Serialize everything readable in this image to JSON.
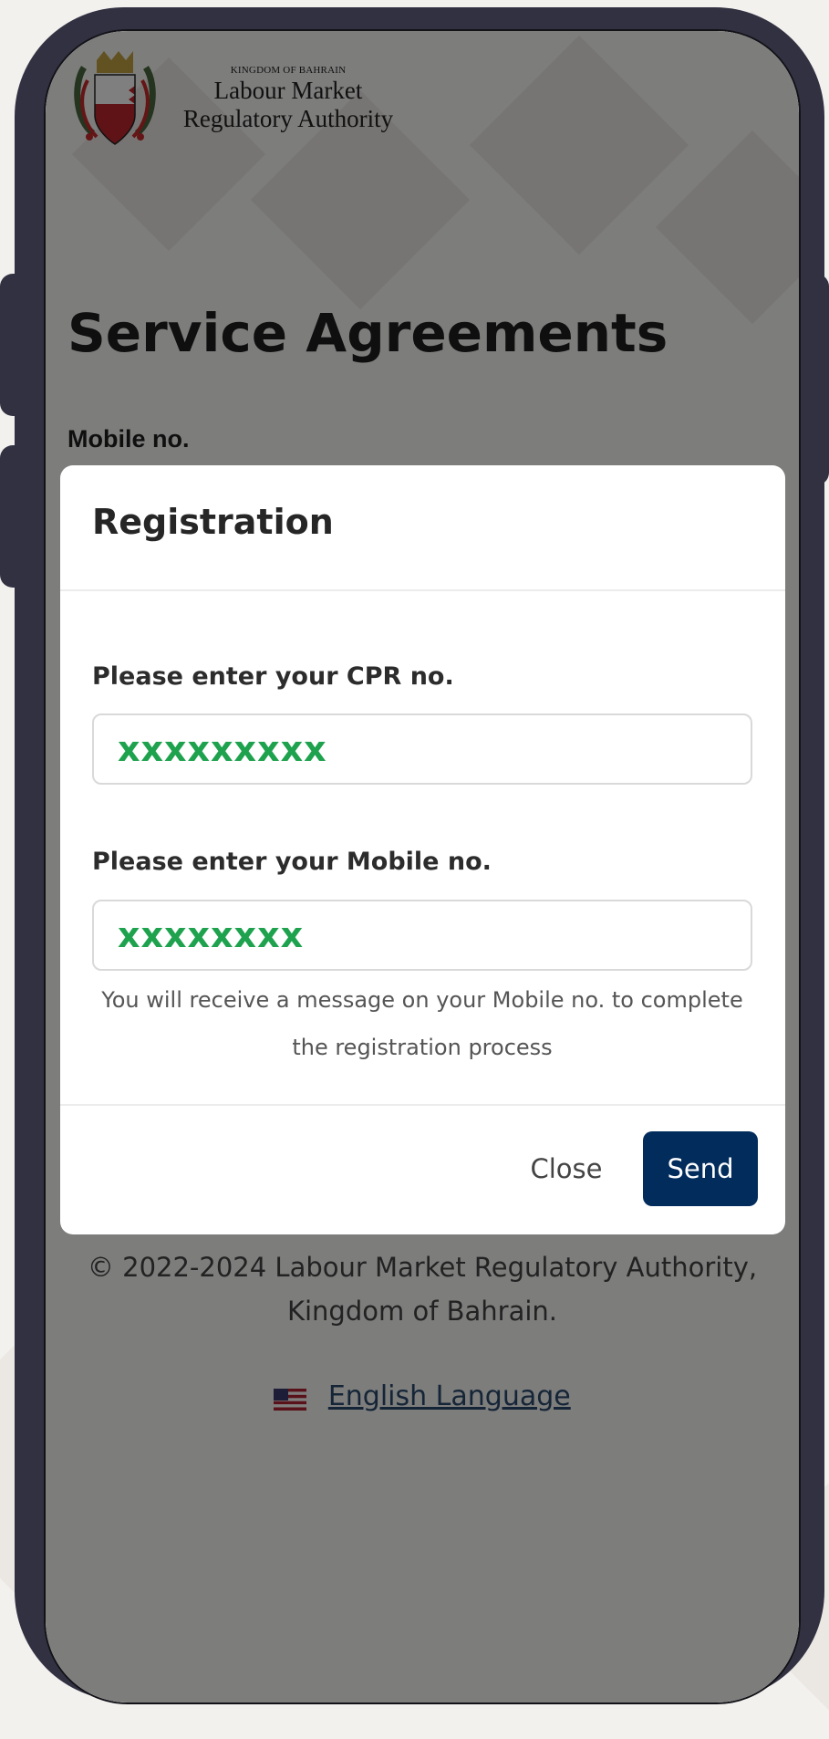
{
  "org": {
    "line1": "KINGDOM OF BAHRAIN",
    "line2": "Labour Market",
    "line3": "Regulatory Authority",
    "logo_icon": "bahrain-coat-of-arms-logo"
  },
  "page": {
    "title": "Service Agreements",
    "mobile_label": "Mobile no."
  },
  "footer": {
    "copyright_line": "© 2022-2024 Labour Market Regulatory Authority,",
    "kingdom": "Kingdom of Bahrain.",
    "language_link": "English Language",
    "flag_icon": "us-flag-icon"
  },
  "modal": {
    "title": "Registration",
    "cpr_label": "Please enter your CPR no.",
    "cpr_value": "xxxxxxxxx",
    "mobile_label": "Please enter your Mobile no.",
    "mobile_value": "xxxxxxxx",
    "help_text": "You will receive a message on your Mobile no. to complete the registration process",
    "close_label": "Close",
    "send_label": "Send"
  },
  "colors": {
    "phone_frame": "#323142",
    "send_button": "#022c5c",
    "input_value_text": "#1ea24e"
  }
}
